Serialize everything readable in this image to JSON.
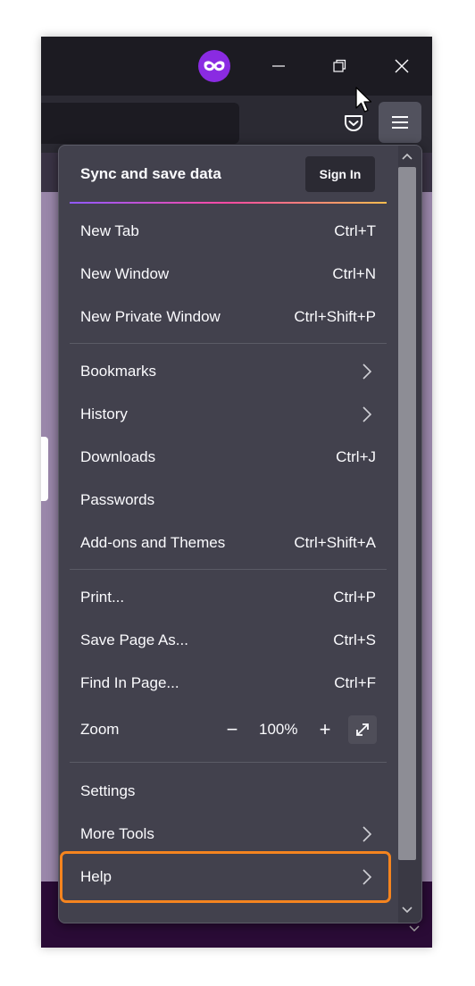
{
  "window": {
    "icons": {
      "private": "private-browsing-mask-icon",
      "minimize": "minimize-icon",
      "restore": "restore-icon",
      "close": "close-icon",
      "pocket": "pocket-icon",
      "menu": "hamburger-menu-icon"
    },
    "colors": {
      "private_icon": "#8a2be2",
      "highlight": "#f5841f"
    }
  },
  "menu": {
    "sync_label": "Sync and save data",
    "sign_in": "Sign In",
    "group1": [
      {
        "label": "New Tab",
        "shortcut": "Ctrl+T"
      },
      {
        "label": "New Window",
        "shortcut": "Ctrl+N"
      },
      {
        "label": "New Private Window",
        "shortcut": "Ctrl+Shift+P"
      }
    ],
    "group2": [
      {
        "label": "Bookmarks",
        "shortcut": ""
      },
      {
        "label": "History",
        "shortcut": ""
      },
      {
        "label": "Downloads",
        "shortcut": "Ctrl+J"
      },
      {
        "label": "Passwords",
        "shortcut": ""
      },
      {
        "label": "Add-ons and Themes",
        "shortcut": "Ctrl+Shift+A"
      }
    ],
    "group3": [
      {
        "label": "Print...",
        "shortcut": "Ctrl+P"
      },
      {
        "label": "Save Page As...",
        "shortcut": "Ctrl+S"
      },
      {
        "label": "Find In Page...",
        "shortcut": "Ctrl+F"
      }
    ],
    "zoom": {
      "label": "Zoom",
      "minus": "−",
      "value": "100%",
      "plus": "+"
    },
    "group4": [
      {
        "label": "Settings",
        "shortcut": ""
      },
      {
        "label": "More Tools",
        "shortcut": ""
      },
      {
        "label": "Help",
        "shortcut": ""
      }
    ]
  }
}
